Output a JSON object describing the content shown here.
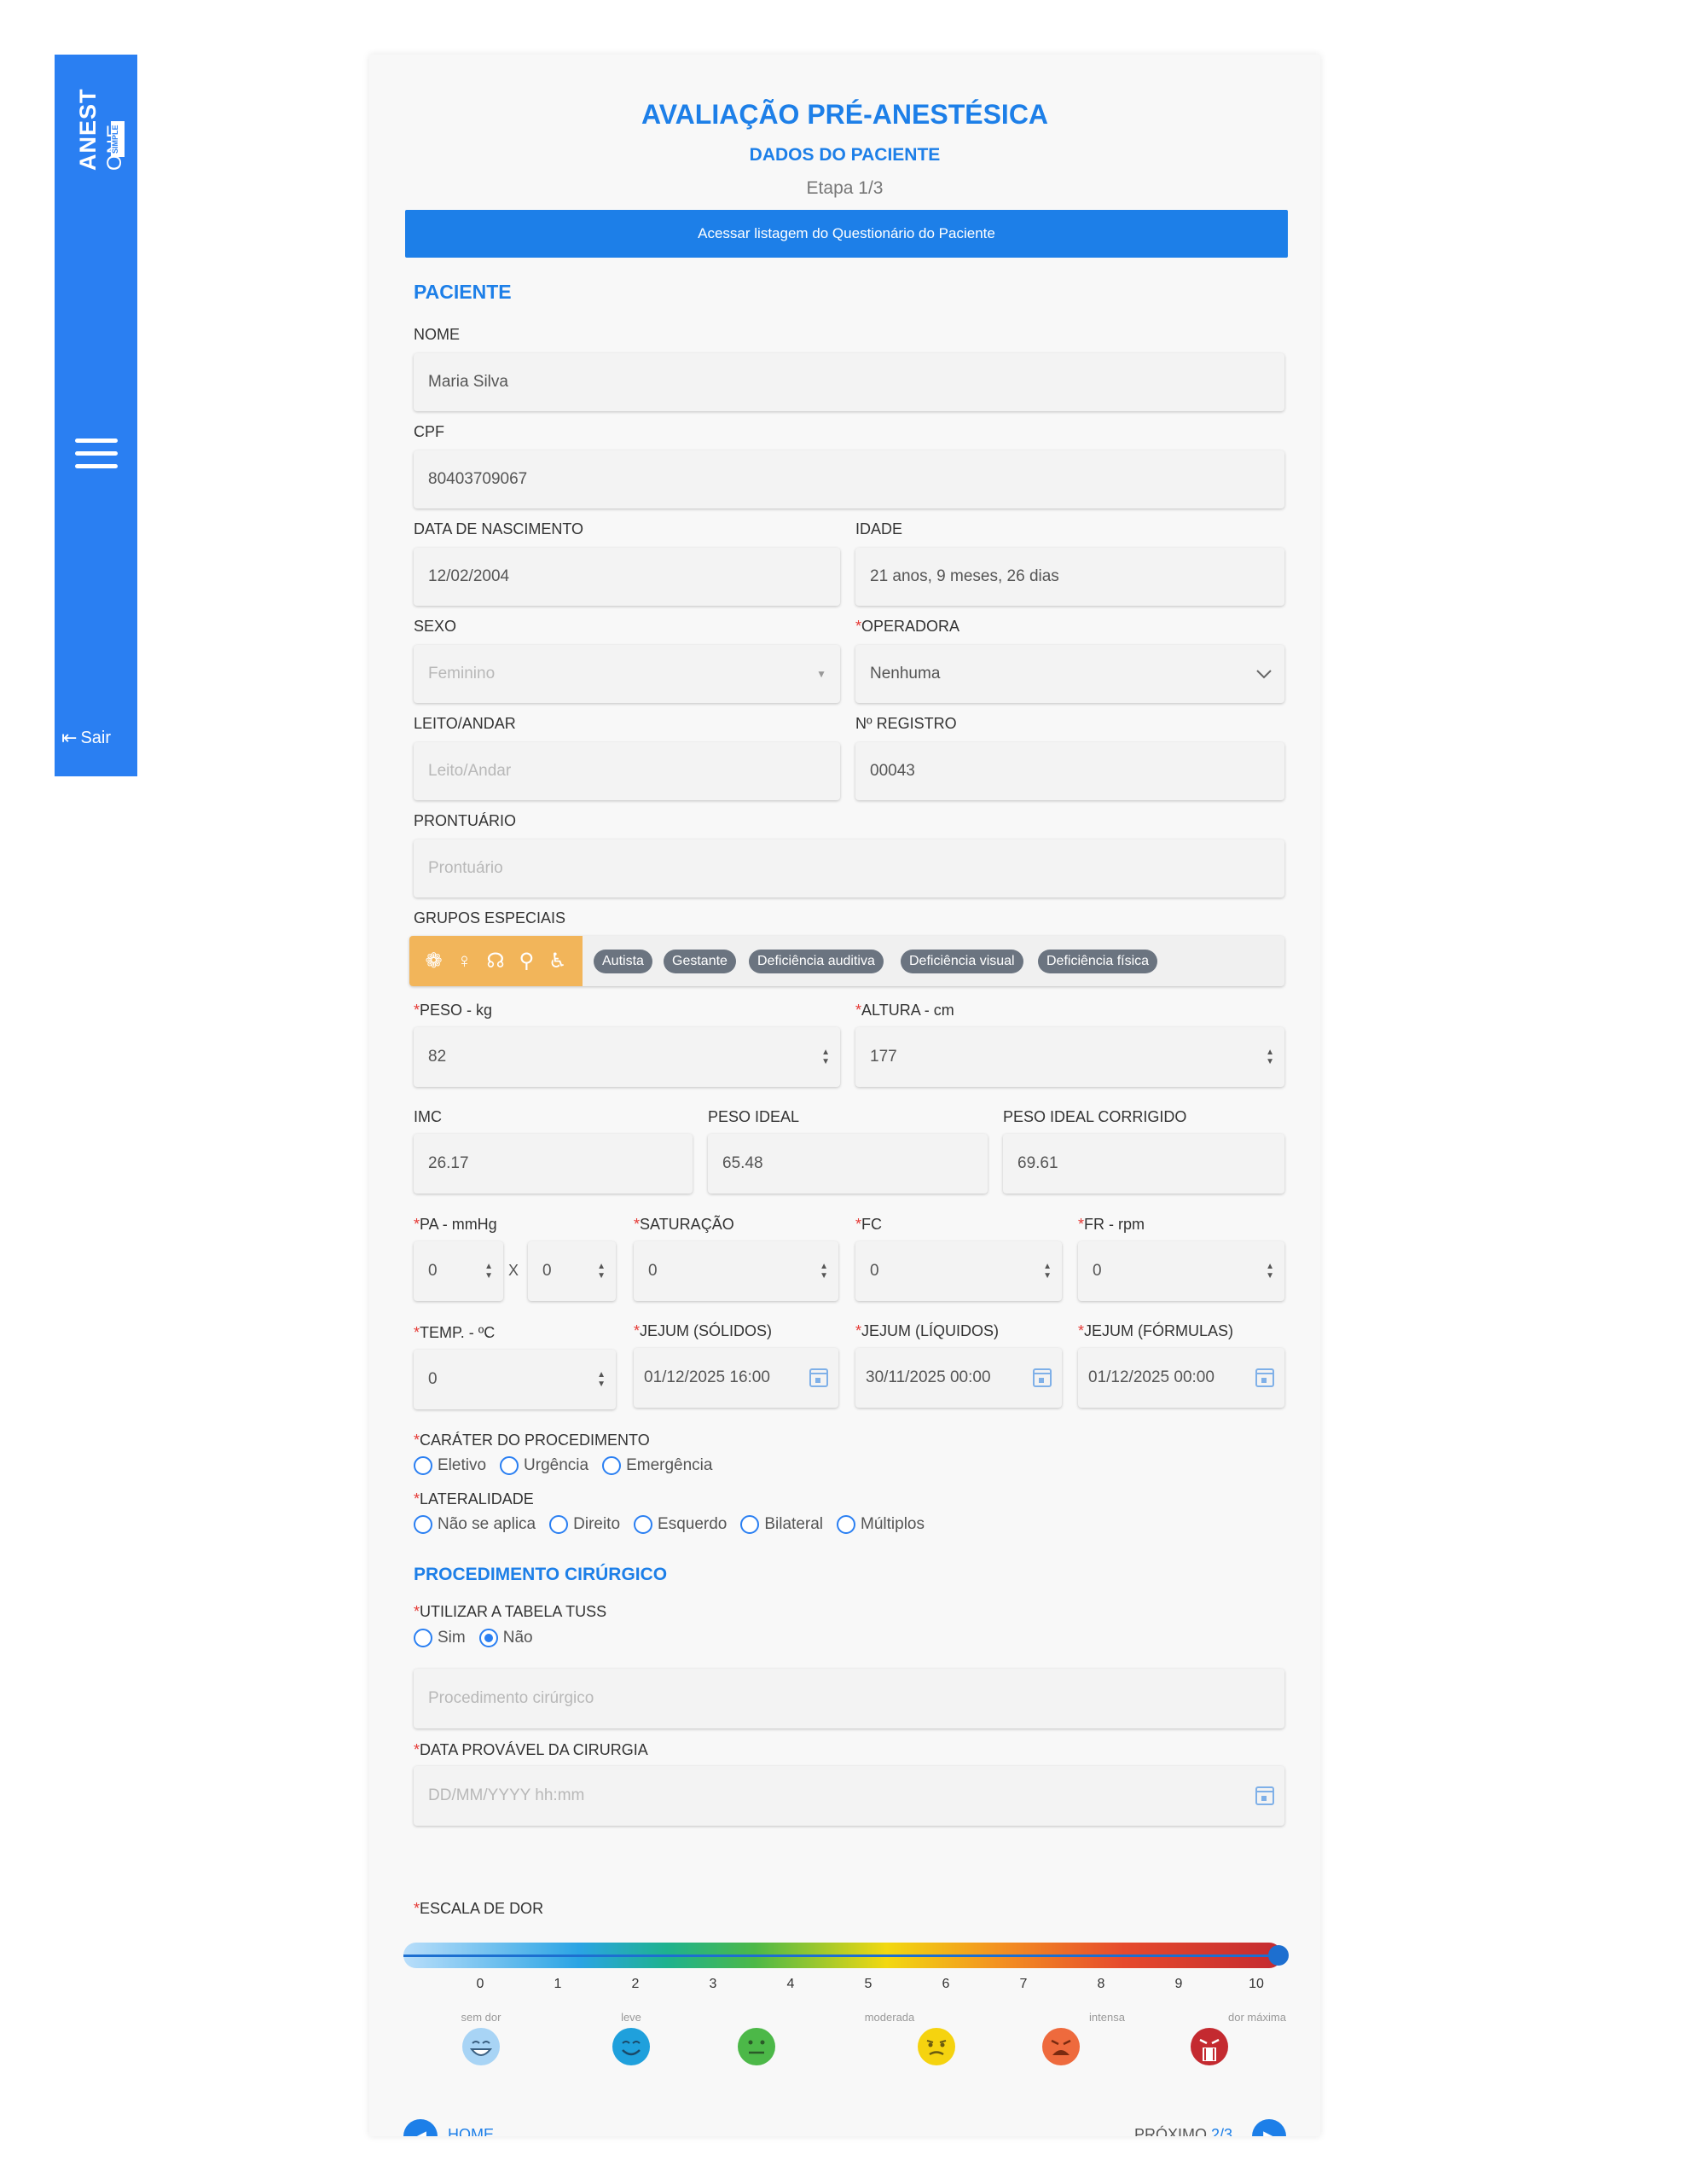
{
  "sidebar": {
    "logo_main": "ANEST",
    "logo_sub": "ONE",
    "logo_badge": "SIMPLE",
    "logout_label": "Sair"
  },
  "header": {
    "title": "AVALIAÇÃO PRÉ-ANESTÉSICA",
    "subtitle": "DADOS DO PACIENTE",
    "step": "Etapa 1/3",
    "questionnaire_button": "Acessar listagem do Questionário do Paciente"
  },
  "paciente": {
    "section_title": "PACIENTE",
    "nome_label": "NOME",
    "nome_value": "Maria Silva",
    "cpf_label": "CPF",
    "cpf_value": "80403709067",
    "nascimento_label": "DATA DE NASCIMENTO",
    "nascimento_value": "12/02/2004",
    "idade_label": "IDADE",
    "idade_value": "21 anos, 9 meses, 26 dias",
    "sexo_label": "SEXO",
    "sexo_value": "Feminino",
    "operadora_label": "OPERADORA",
    "operadora_value": "Nenhuma",
    "leito_label": "LEITO/ANDAR",
    "leito_placeholder": "Leito/Andar",
    "registro_label": "Nº REGISTRO",
    "registro_value": "00043",
    "prontuario_label": "PRONTUÁRIO",
    "prontuario_placeholder": "Prontuário",
    "grupos_label": "GRUPOS ESPECIAIS",
    "grupos": [
      "Autista",
      "Gestante",
      "Deficiência auditiva",
      "Deficiência visual",
      "Deficiência física"
    ]
  },
  "medidas": {
    "peso_label": "PESO - kg",
    "peso_value": "82",
    "altura_label": "ALTURA - cm",
    "altura_value": "177",
    "imc_label": "IMC",
    "imc_value": "26.17",
    "peso_ideal_label": "PESO IDEAL",
    "peso_ideal_value": "65.48",
    "peso_corrigido_label": "PESO IDEAL CORRIGIDO",
    "peso_corrigido_value": "69.61",
    "pa_label": "PA - mmHg",
    "pa_sys": "0",
    "pa_x": "X",
    "pa_dia": "0",
    "sat_label": "SATURAÇÃO",
    "sat_value": "0",
    "fc_label": "FC",
    "fc_value": "0",
    "fr_label": "FR - rpm",
    "fr_value": "0",
    "temp_label": "TEMP. - ºC",
    "temp_value": "0",
    "jejum_solidos_label": "JEJUM (SÓLIDOS)",
    "jejum_solidos_value": "01/12/2025 16:00",
    "jejum_liquidos_label": "JEJUM (LÍQUIDOS)",
    "jejum_liquidos_value": "30/11/2025 00:00",
    "jejum_formulas_label": "JEJUM (FÓRMULAS)",
    "jejum_formulas_value": "01/12/2025 00:00"
  },
  "carater": {
    "label": "CARÁTER DO PROCEDIMENTO",
    "options": [
      "Eletivo",
      "Urgência",
      "Emergência"
    ]
  },
  "lateralidade": {
    "label": "LATERALIDADE",
    "options": [
      "Não se aplica",
      "Direito",
      "Esquerdo",
      "Bilateral",
      "Múltiplos"
    ]
  },
  "procedimento": {
    "section_title": "PROCEDIMENTO CIRÚRGICO",
    "tuss_label": "UTILIZAR A TABELA TUSS",
    "tuss_options": [
      "Sim",
      "Não"
    ],
    "tuss_selected": "Não",
    "procedimento_placeholder": "Procedimento cirúrgico",
    "data_label": "DATA PROVÁVEL DA CIRURGIA",
    "data_placeholder": "DD/MM/YYYY hh:mm"
  },
  "dor": {
    "label": "ESCALA DE DOR",
    "value": 10,
    "ticks": [
      "0",
      "1",
      "2",
      "3",
      "4",
      "5",
      "6",
      "7",
      "8",
      "9",
      "10"
    ],
    "face_labels": [
      "sem dor",
      "leve",
      "moderada",
      "intensa",
      "dor máxima"
    ],
    "colors": {
      "none": "#a8d4f5",
      "light": "#1fa0dc",
      "moderate": "#4cb848",
      "mid": "#f5d30f",
      "intense": "#ee6a3d",
      "max": "#c42a30"
    }
  },
  "footer": {
    "home_label": "HOME",
    "next_label": "PRÓXIMO",
    "next_step": "2/3"
  }
}
